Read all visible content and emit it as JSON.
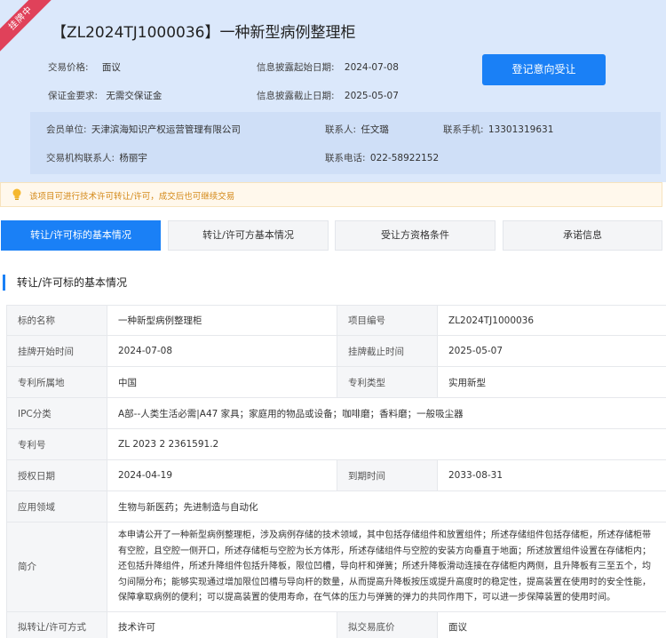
{
  "ribbon": "挂牌中",
  "title": "【ZL2024TJ1000036】一种新型病例整理柜",
  "summary": {
    "price_label": "交易价格:",
    "price_value": "面议",
    "deposit_label": "保证金要求:",
    "deposit_value": "无需交保证金",
    "start_label": "信息披露起始日期:",
    "start_value": "2024-07-08",
    "end_label": "信息披露截止日期:",
    "end_value": "2025-05-07",
    "register_button": "登记意向受让"
  },
  "member": {
    "unit_label": "会员单位:",
    "unit_value": "天津滨海知识产权运营管理有限公司",
    "contact_label": "联系人:",
    "contact_value": "任文璐",
    "mobile_label": "联系手机:",
    "mobile_value": "13301319631",
    "agency_contact_label": "交易机构联系人:",
    "agency_contact_value": "杨丽宇",
    "phone_label": "联系电话:",
    "phone_value": "022-58922152"
  },
  "notice": "该项目可进行技术许可转让/许可，成交后也可继续交易",
  "tabs": [
    "转让/许可标的基本情况",
    "转让/许可方基本情况",
    "受让方资格条件",
    "承诺信息"
  ],
  "section_title": "转让/许可标的基本情况",
  "table": {
    "name_label": "标的名称",
    "name_value": "一种新型病例整理柜",
    "project_no_label": "项目编号",
    "project_no_value": "ZL2024TJ1000036",
    "list_start_label": "挂牌开始时间",
    "list_start_value": "2024-07-08",
    "list_end_label": "挂牌截止时间",
    "list_end_value": "2025-05-07",
    "region_label": "专利所属地",
    "region_value": "中国",
    "patent_type_label": "专利类型",
    "patent_type_value": "实用新型",
    "ipc_label": "IPC分类",
    "ipc_value": "A部--人类生活必需|A47 家具；家庭用的物品或设备；咖啡磨；香料磨；一般吸尘器",
    "patent_no_label": "专利号",
    "patent_no_value": "ZL 2023 2 2361591.2",
    "grant_date_label": "授权日期",
    "grant_date_value": "2024-04-19",
    "expire_label": "到期时间",
    "expire_value": "2033-08-31",
    "field_label": "应用领域",
    "field_value": "生物与新医药；先进制造与自动化",
    "abstract_label": "简介",
    "abstract_value": "本申请公开了一种新型病例整理柜，涉及病例存储的技术领域，其中包括存储组件和放置组件；所述存储组件包括存储柜，所述存储柜带有空腔，且空腔一侧开口，所述存储柜与空腔为长方体形，所述存储组件与空腔的安装方向垂直于地面；所述放置组件设置在存储柜内；还包括升降组件，所述升降组件包括升降板，限位凹槽，导向杆和弹簧；所述升降板滑动连接在存储柜内两侧，且升降板有三至五个，均匀间隔分布；能够实现通过增加限位凹槽与导向杆的数量，从而提高升降板按压或提升高度时的稳定性，提高装置在使用时的安全性能，保障拿取病例的便利；可以提高装置的使用寿命，在气体的压力与弹簧的弹力的共同作用下，可以进一步保障装置的使用时间。",
    "method_label": "拟转让/许可方式",
    "method_value": "技术许可",
    "price_label": "拟交易底价",
    "price_value": "面议"
  }
}
